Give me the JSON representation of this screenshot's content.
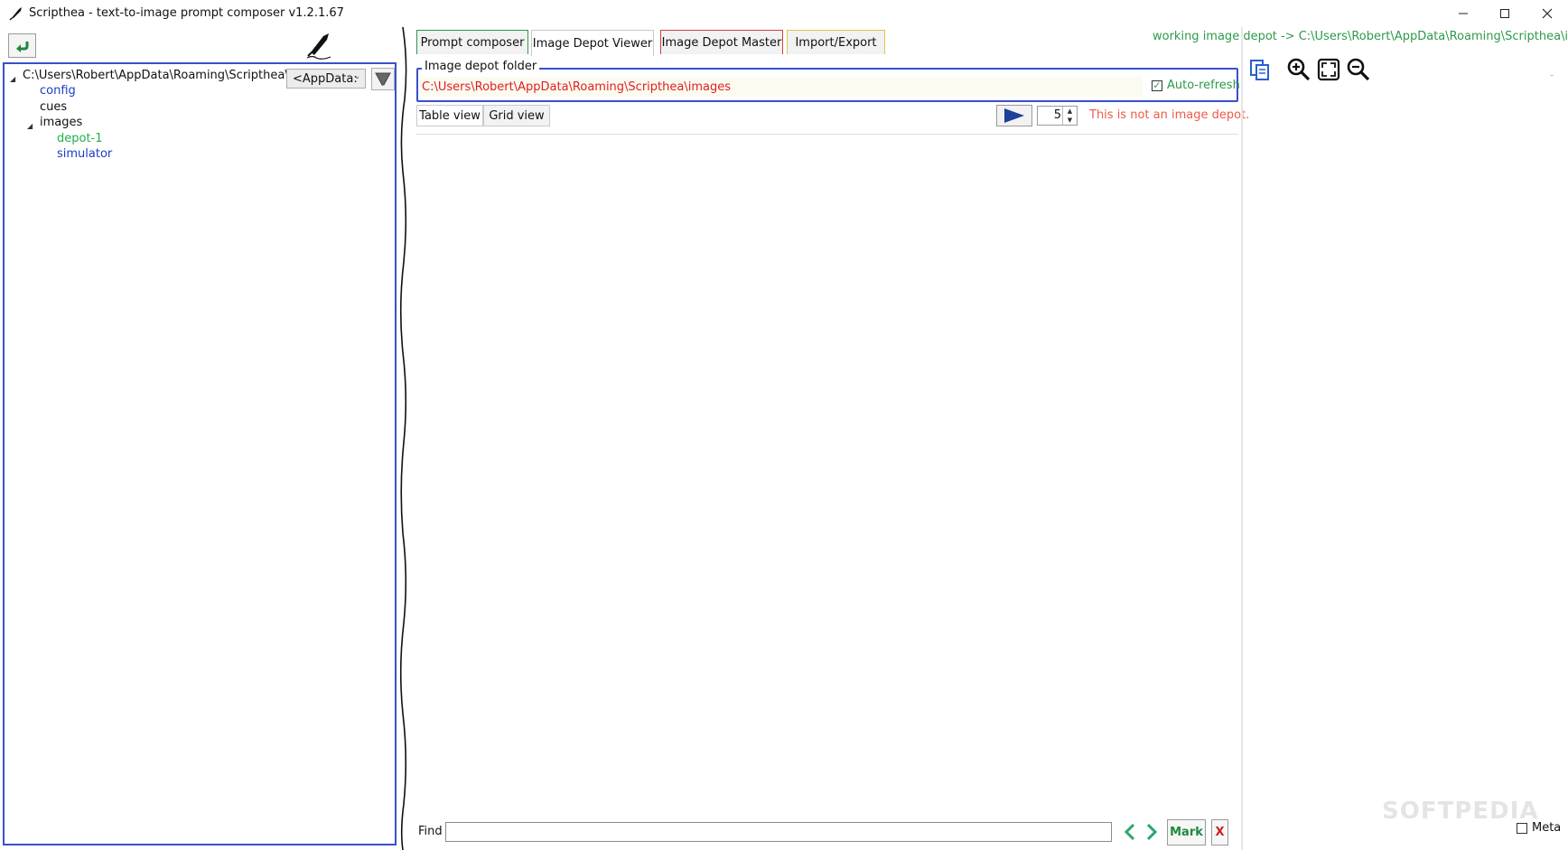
{
  "window": {
    "title": "Scripthea - text-to-image prompt composer v1.2.1.67",
    "minimize": "—",
    "maximize": "☐",
    "close": "✕"
  },
  "tree": {
    "root": "C:\\Users\\Robert\\AppData\\Roaming\\Scripthea\\",
    "items": [
      {
        "label": "config",
        "color": "#1a3cc8"
      },
      {
        "label": "cues",
        "color": "#111111"
      },
      {
        "label": "images",
        "color": "#111111"
      },
      {
        "label": "depot-1",
        "color": "#22b14c"
      },
      {
        "label": "simulator",
        "color": "#1a3cc8"
      }
    ],
    "root_select": "<AppData:"
  },
  "tabs": [
    {
      "label": "Prompt composer",
      "accent": "#2e9a4a"
    },
    {
      "label": "Image Depot Viewer",
      "accent": "#c9c9c9"
    },
    {
      "label": "Image Depot Master",
      "accent": "#d04040"
    },
    {
      "label": "Import/Export",
      "accent": "#e3c24a"
    }
  ],
  "working_depot": "working image depot -> C:\\Users\\Robert\\AppData\\Roaming\\Scripthea\\images",
  "depot": {
    "group_label": "Image depot folder",
    "path": "C:\\Users\\Robert\\AppData\\Roaming\\Scripthea\\images",
    "auto_refresh_label": "Auto-refresh",
    "auto_refresh_check": "✓",
    "not_depot_msg": "This is not an image depot."
  },
  "views": {
    "table": "Table view",
    "grid": "Grid view",
    "count": "5"
  },
  "find": {
    "label": "Find",
    "mark": "Mark",
    "clear": "X"
  },
  "right": {
    "meta_label": "Meta",
    "watermark": "SOFTPEDIA",
    "dash": "-"
  },
  "colors": {
    "accent_blue": "#3a4fcc",
    "green": "#2e9a4a",
    "red": "#e02020",
    "play_blue": "#1e3f9a"
  }
}
